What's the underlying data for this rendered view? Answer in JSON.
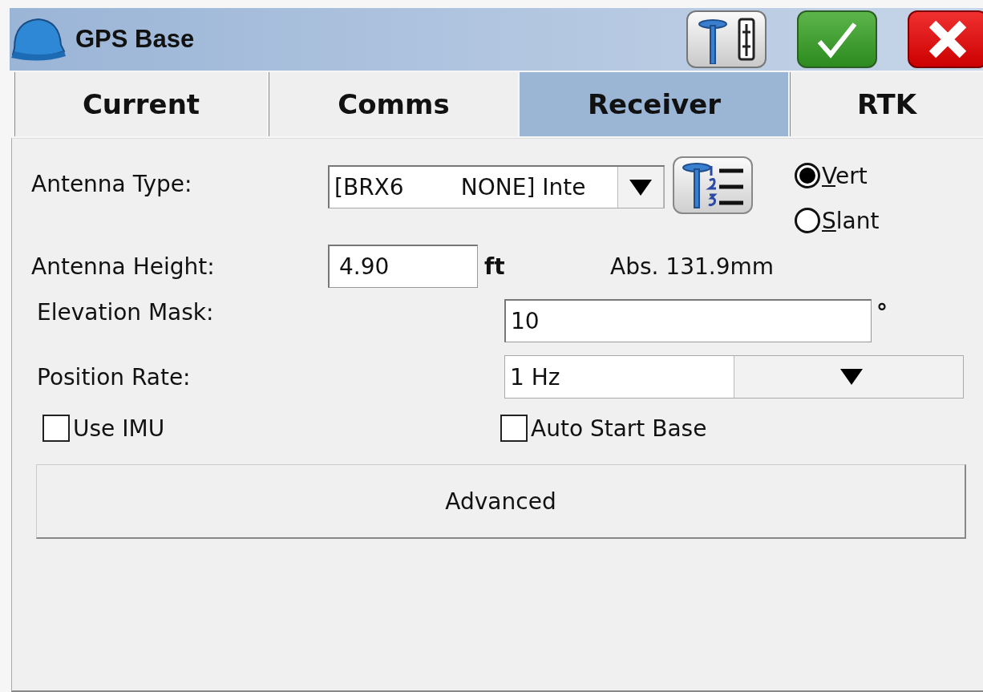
{
  "window": {
    "title": "GPS Base"
  },
  "toolbar_buttons": [
    {
      "kind": "antenna"
    },
    {
      "kind": "ok"
    },
    {
      "kind": "cancel"
    }
  ],
  "tabs": [
    {
      "label": "Current",
      "selected": false
    },
    {
      "label": "Comms",
      "selected": false
    },
    {
      "label": "Receiver",
      "selected": true
    },
    {
      "label": "RTK",
      "selected": false
    }
  ],
  "antenna_type": {
    "label": "Antenna Type:",
    "value": "[BRX6        NONE] Inte"
  },
  "height_mode": [
    {
      "label": "Vert",
      "selected": true
    },
    {
      "label": "Slant",
      "selected": false
    }
  ],
  "antenna_height": {
    "label": "Antenna Height:",
    "value": "4.90",
    "unit": "ft",
    "absolute": "Abs. 131.9mm"
  },
  "elevation_mask": {
    "label": "Elevation Mask:",
    "value": "10",
    "unit": "°"
  },
  "position_rate": {
    "label": "Position Rate:",
    "value": "1 Hz"
  },
  "checkboxes": [
    {
      "label": "Use IMU",
      "checked": false
    },
    {
      "label": "Auto Start Base",
      "checked": false
    }
  ],
  "buttons": [
    "Advanced"
  ]
}
